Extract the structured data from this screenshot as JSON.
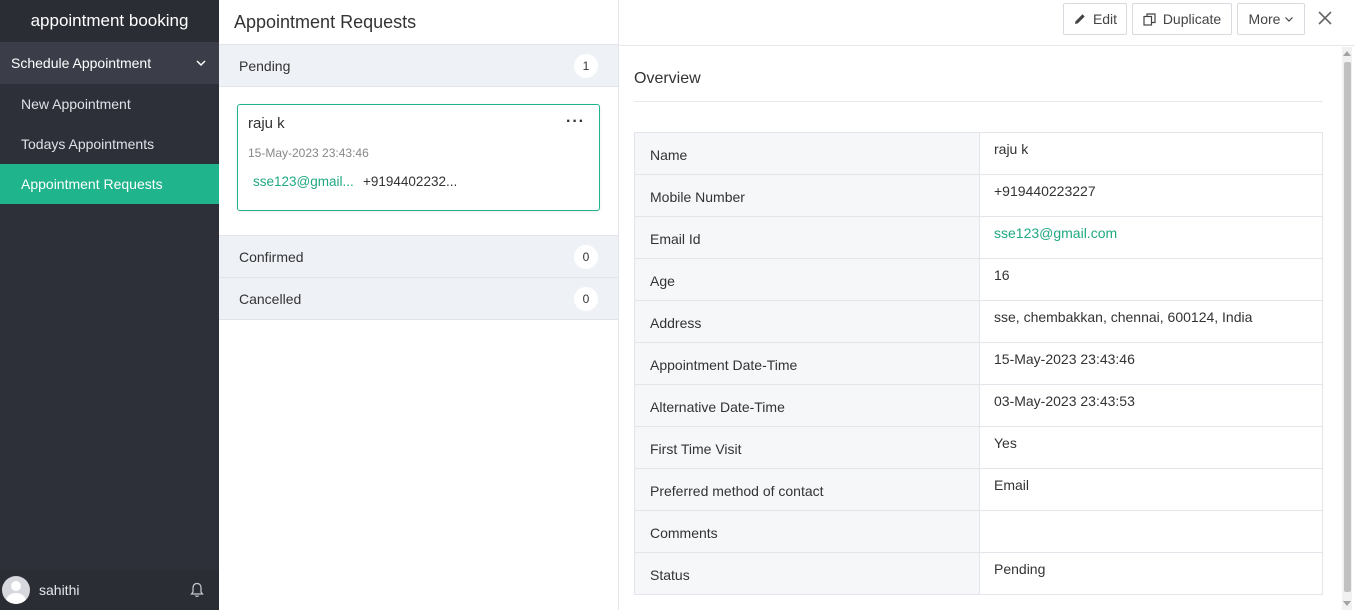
{
  "app": {
    "title": "appointment booking"
  },
  "sidebar": {
    "section_label": "Schedule Appointment",
    "items": [
      {
        "label": "New Appointment",
        "active": false
      },
      {
        "label": "Todays Appointments",
        "active": false
      },
      {
        "label": "Appointment Requests",
        "active": true
      }
    ],
    "user_name": "sahithi"
  },
  "list": {
    "title": "Appointment Requests",
    "groups": {
      "pending": {
        "label": "Pending",
        "count": "1"
      },
      "confirmed": {
        "label": "Confirmed",
        "count": "0"
      },
      "cancelled": {
        "label": "Cancelled",
        "count": "0"
      }
    },
    "card": {
      "name": "raju k",
      "menu": "···",
      "date": "15-May-2023 23:43:46",
      "email": "sse123@gmail...",
      "phone": "+9194402232..."
    }
  },
  "toolbar": {
    "edit_label": "Edit",
    "duplicate_label": "Duplicate",
    "more_label": "More"
  },
  "detail": {
    "heading": "Overview",
    "fields": [
      {
        "label": "Name",
        "value": "raju k"
      },
      {
        "label": "Mobile Number",
        "value": "+919440223227"
      },
      {
        "label": "Email Id",
        "value": "sse123@gmail.com"
      },
      {
        "label": "Age",
        "value": "16"
      },
      {
        "label": "Address",
        "value": "sse, chembakkan, chennai, 600124, India"
      },
      {
        "label": "Appointment Date-Time",
        "value": "15-May-2023 23:43:46"
      },
      {
        "label": "Alternative Date-Time",
        "value": "03-May-2023 23:43:53"
      },
      {
        "label": "First Time Visit",
        "value": "Yes"
      },
      {
        "label": "Preferred method of contact",
        "value": "Email"
      },
      {
        "label": "Comments",
        "value": ""
      },
      {
        "label": "Status",
        "value": "Pending"
      }
    ]
  },
  "colors": {
    "accent": "#1fb48c",
    "sidebar_bg": "#2e3039",
    "link": "#1fa882"
  },
  "icons": [
    "chevron-down-icon",
    "avatar-icon",
    "bell-icon",
    "pencil-icon",
    "duplicate-icon",
    "close-icon"
  ]
}
